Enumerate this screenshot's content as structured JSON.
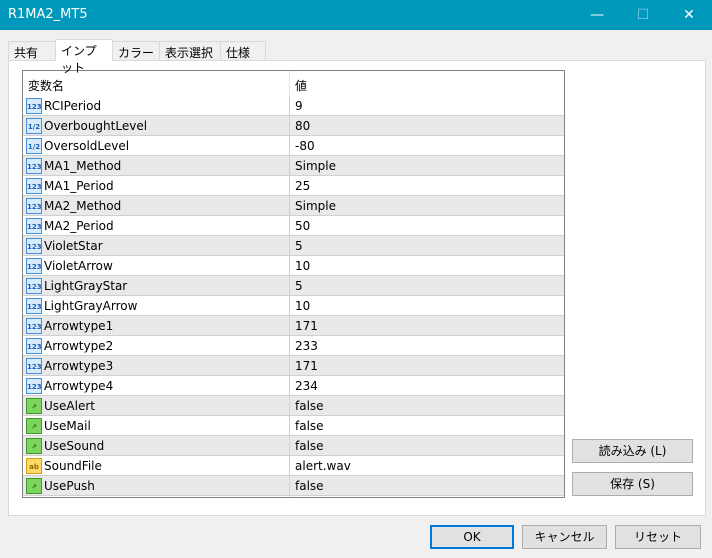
{
  "window": {
    "title": "R1MA2_MT5",
    "minimize": "—",
    "maximize": "☐",
    "close": "✕"
  },
  "tabs": [
    "共有",
    "インプット",
    "カラー",
    "表示選択",
    "仕様"
  ],
  "grid": {
    "col_name": "変数名",
    "col_value": "値",
    "rows": [
      {
        "icon": "int",
        "name": "RCIPeriod",
        "value": "9"
      },
      {
        "icon": "double",
        "name": "OverboughtLevel",
        "value": "80"
      },
      {
        "icon": "double",
        "name": "OversoldLevel",
        "value": "-80"
      },
      {
        "icon": "int",
        "name": "MA1_Method",
        "value": "Simple"
      },
      {
        "icon": "int",
        "name": "MA1_Period",
        "value": "25"
      },
      {
        "icon": "int",
        "name": "MA2_Method",
        "value": "Simple"
      },
      {
        "icon": "int",
        "name": "MA2_Period",
        "value": "50"
      },
      {
        "icon": "int",
        "name": "VioletStar",
        "value": "5"
      },
      {
        "icon": "int",
        "name": "VioletArrow",
        "value": "10"
      },
      {
        "icon": "int",
        "name": "LightGrayStar",
        "value": "5"
      },
      {
        "icon": "int",
        "name": "LightGrayArrow",
        "value": "10"
      },
      {
        "icon": "int",
        "name": "Arrowtype1",
        "value": "171"
      },
      {
        "icon": "int",
        "name": "Arrowtype2",
        "value": "233"
      },
      {
        "icon": "int",
        "name": "Arrowtype3",
        "value": "171"
      },
      {
        "icon": "int",
        "name": "Arrowtype4",
        "value": "234"
      },
      {
        "icon": "bool",
        "name": "UseAlert",
        "value": "false"
      },
      {
        "icon": "bool",
        "name": "UseMail",
        "value": "false"
      },
      {
        "icon": "bool",
        "name": "UseSound",
        "value": "false"
      },
      {
        "icon": "string",
        "name": "SoundFile",
        "value": "alert.wav"
      },
      {
        "icon": "bool",
        "name": "UsePush",
        "value": "false"
      }
    ]
  },
  "icon_glyphs": {
    "int": "123",
    "double": "1/2",
    "bool": "↗",
    "string": "ab"
  },
  "buttons": {
    "load": "読み込み (L)",
    "save": "保存 (S)",
    "ok": "OK",
    "cancel": "キャンセル",
    "reset": "リセット"
  }
}
